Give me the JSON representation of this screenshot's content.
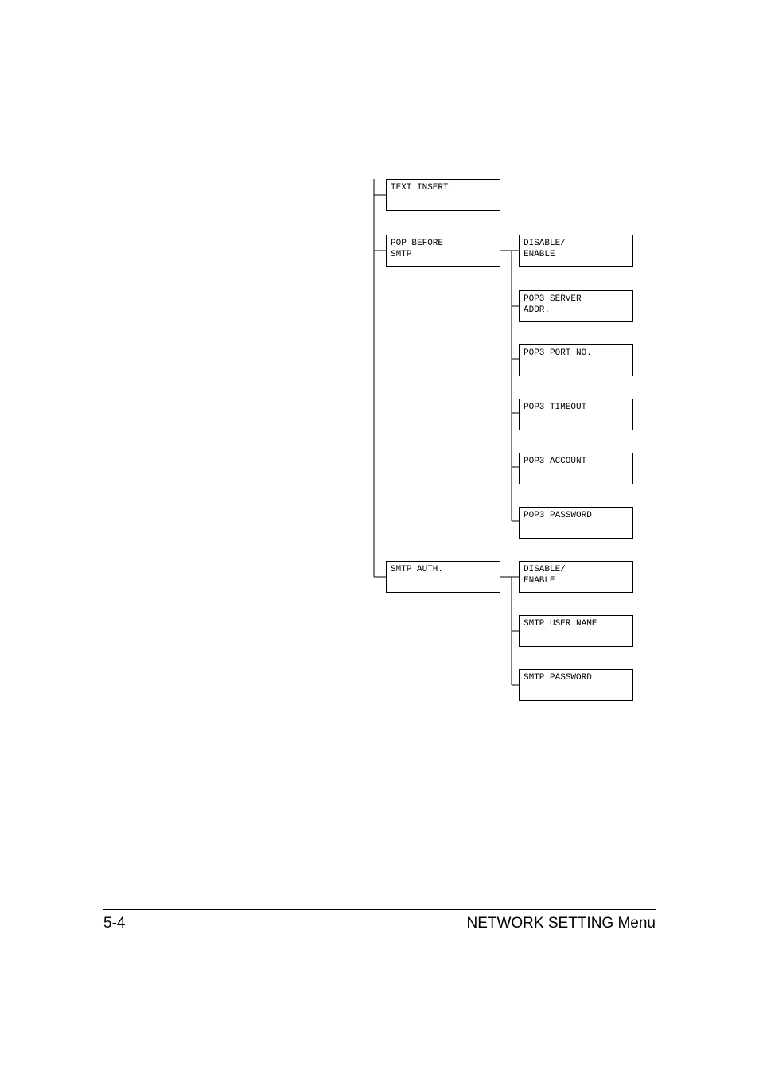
{
  "menu": {
    "text_insert": "TEXT INSERT",
    "pop_before_smtp": "POP BEFORE\nSMTP",
    "smtp_auth": "SMTP AUTH.",
    "pop": {
      "disable_enable": "DISABLE/\nENABLE",
      "server_addr": "POP3 SERVER\nADDR.",
      "port_no": "POP3 PORT NO.",
      "timeout": "POP3 TIMEOUT",
      "account": "POP3 ACCOUNT",
      "password": "POP3 PASSWORD"
    },
    "smtp": {
      "disable_enable": "DISABLE/\nENABLE",
      "user_name": "SMTP USER NAME",
      "password": "SMTP PASSWORD"
    }
  },
  "footer": {
    "page": "5-4",
    "title": "NETWORK SETTING Menu"
  }
}
